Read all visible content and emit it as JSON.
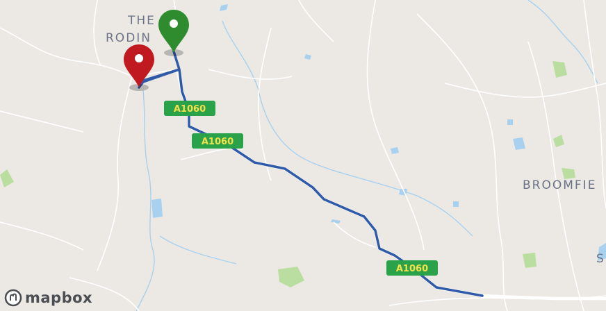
{
  "map": {
    "places": {
      "the_rodings_line1": "THE",
      "the_rodings_line2": "RODIN",
      "broomfield": "BROOMFIE",
      "s_partial": "S"
    },
    "road_labels": [
      "A1060",
      "A1060",
      "A1060"
    ],
    "markers": {
      "start": {
        "color": "#2e8b2e",
        "icon": "map-pin-icon"
      },
      "end": {
        "color": "#c0191f",
        "icon": "map-pin-icon"
      }
    },
    "route": {
      "color": "#2f5aa8"
    },
    "attribution": {
      "logo_text": "mapbox",
      "icon": "mapbox-logo-icon"
    }
  }
}
